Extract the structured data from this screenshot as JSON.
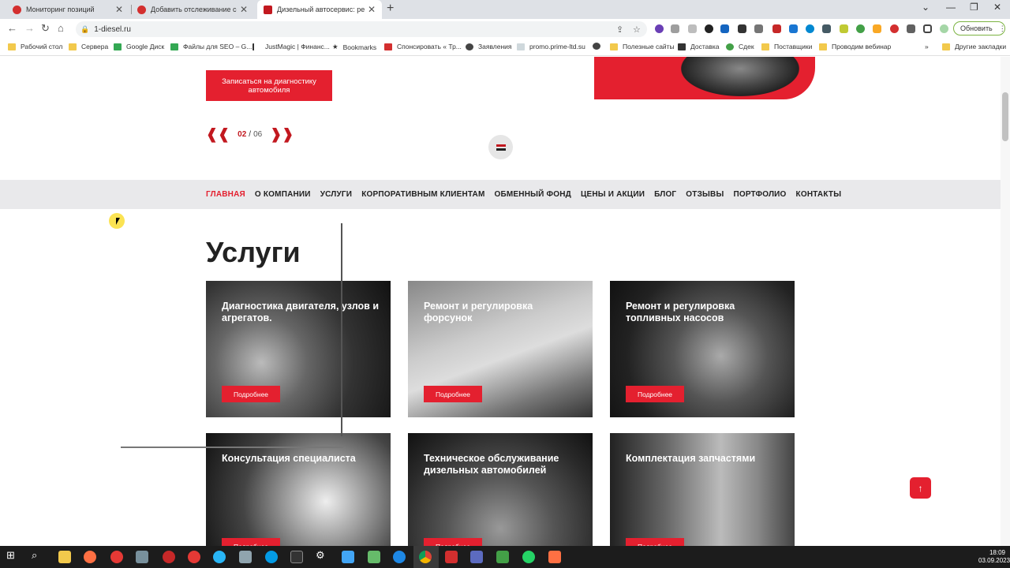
{
  "browser": {
    "tabs": [
      {
        "title": "Мониторинг позиций",
        "active": false
      },
      {
        "title": "Добавить отслеживание ссылок",
        "active": false
      },
      {
        "title": "Дизельный автосервис: ремонт",
        "active": true
      }
    ],
    "new_tab": "+",
    "url": "1-diesel.ru",
    "update_button": "Обновить",
    "bookmarks": [
      "Рабочий стол",
      "Сервера",
      "Google Диск",
      "Файлы для SEO – G...",
      "JustMagic | Финанс...",
      "Bookmarks",
      "Спонсировать « Тр...",
      "Заявления",
      "promo.prime-ltd.su",
      "Полезные сайты",
      "Доставка",
      "Сдек",
      "Поставщики",
      "Проводим вебинар",
      "Другие закладки"
    ],
    "bookmarks_more": "»"
  },
  "hero": {
    "cta": "Записаться на диагностику автомобиля",
    "pager_current": "02",
    "pager_sep": "/",
    "pager_total": "06",
    "prev_arrow": "❰❰",
    "next_arrow": "❱❱"
  },
  "nav": {
    "items": [
      "ГЛАВНАЯ",
      "О КОМПАНИИ",
      "УСЛУГИ",
      "КОРПОРАТИВНЫМ КЛИЕНТАМ",
      "ОБМЕННЫЙ ФОНД",
      "ЦЕНЫ И АКЦИИ",
      "БЛОГ",
      "ОТЗЫВЫ",
      "ПОРТФОЛИО",
      "КОНТАКТЫ"
    ],
    "active_index": 0
  },
  "services": {
    "title": "Услуги",
    "more_label": "Подробнее",
    "cards": [
      {
        "title": "Диагностика двигателя, узлов и агрегатов."
      },
      {
        "title": "Ремонт и регулировка форсунок"
      },
      {
        "title": "Ремонт и регулировка топливных насосов"
      },
      {
        "title": "Консультация специалиста"
      },
      {
        "title": "Техническое обслуживание дизельных автомобилей"
      },
      {
        "title": "Комплектация запчастями"
      }
    ]
  },
  "taskbar": {
    "time": "18:09",
    "date": "03.09.2023"
  },
  "colors": {
    "accent": "#e4202f",
    "nav_band": "#e9e9eb",
    "taskbar": "#1c1c1c"
  }
}
